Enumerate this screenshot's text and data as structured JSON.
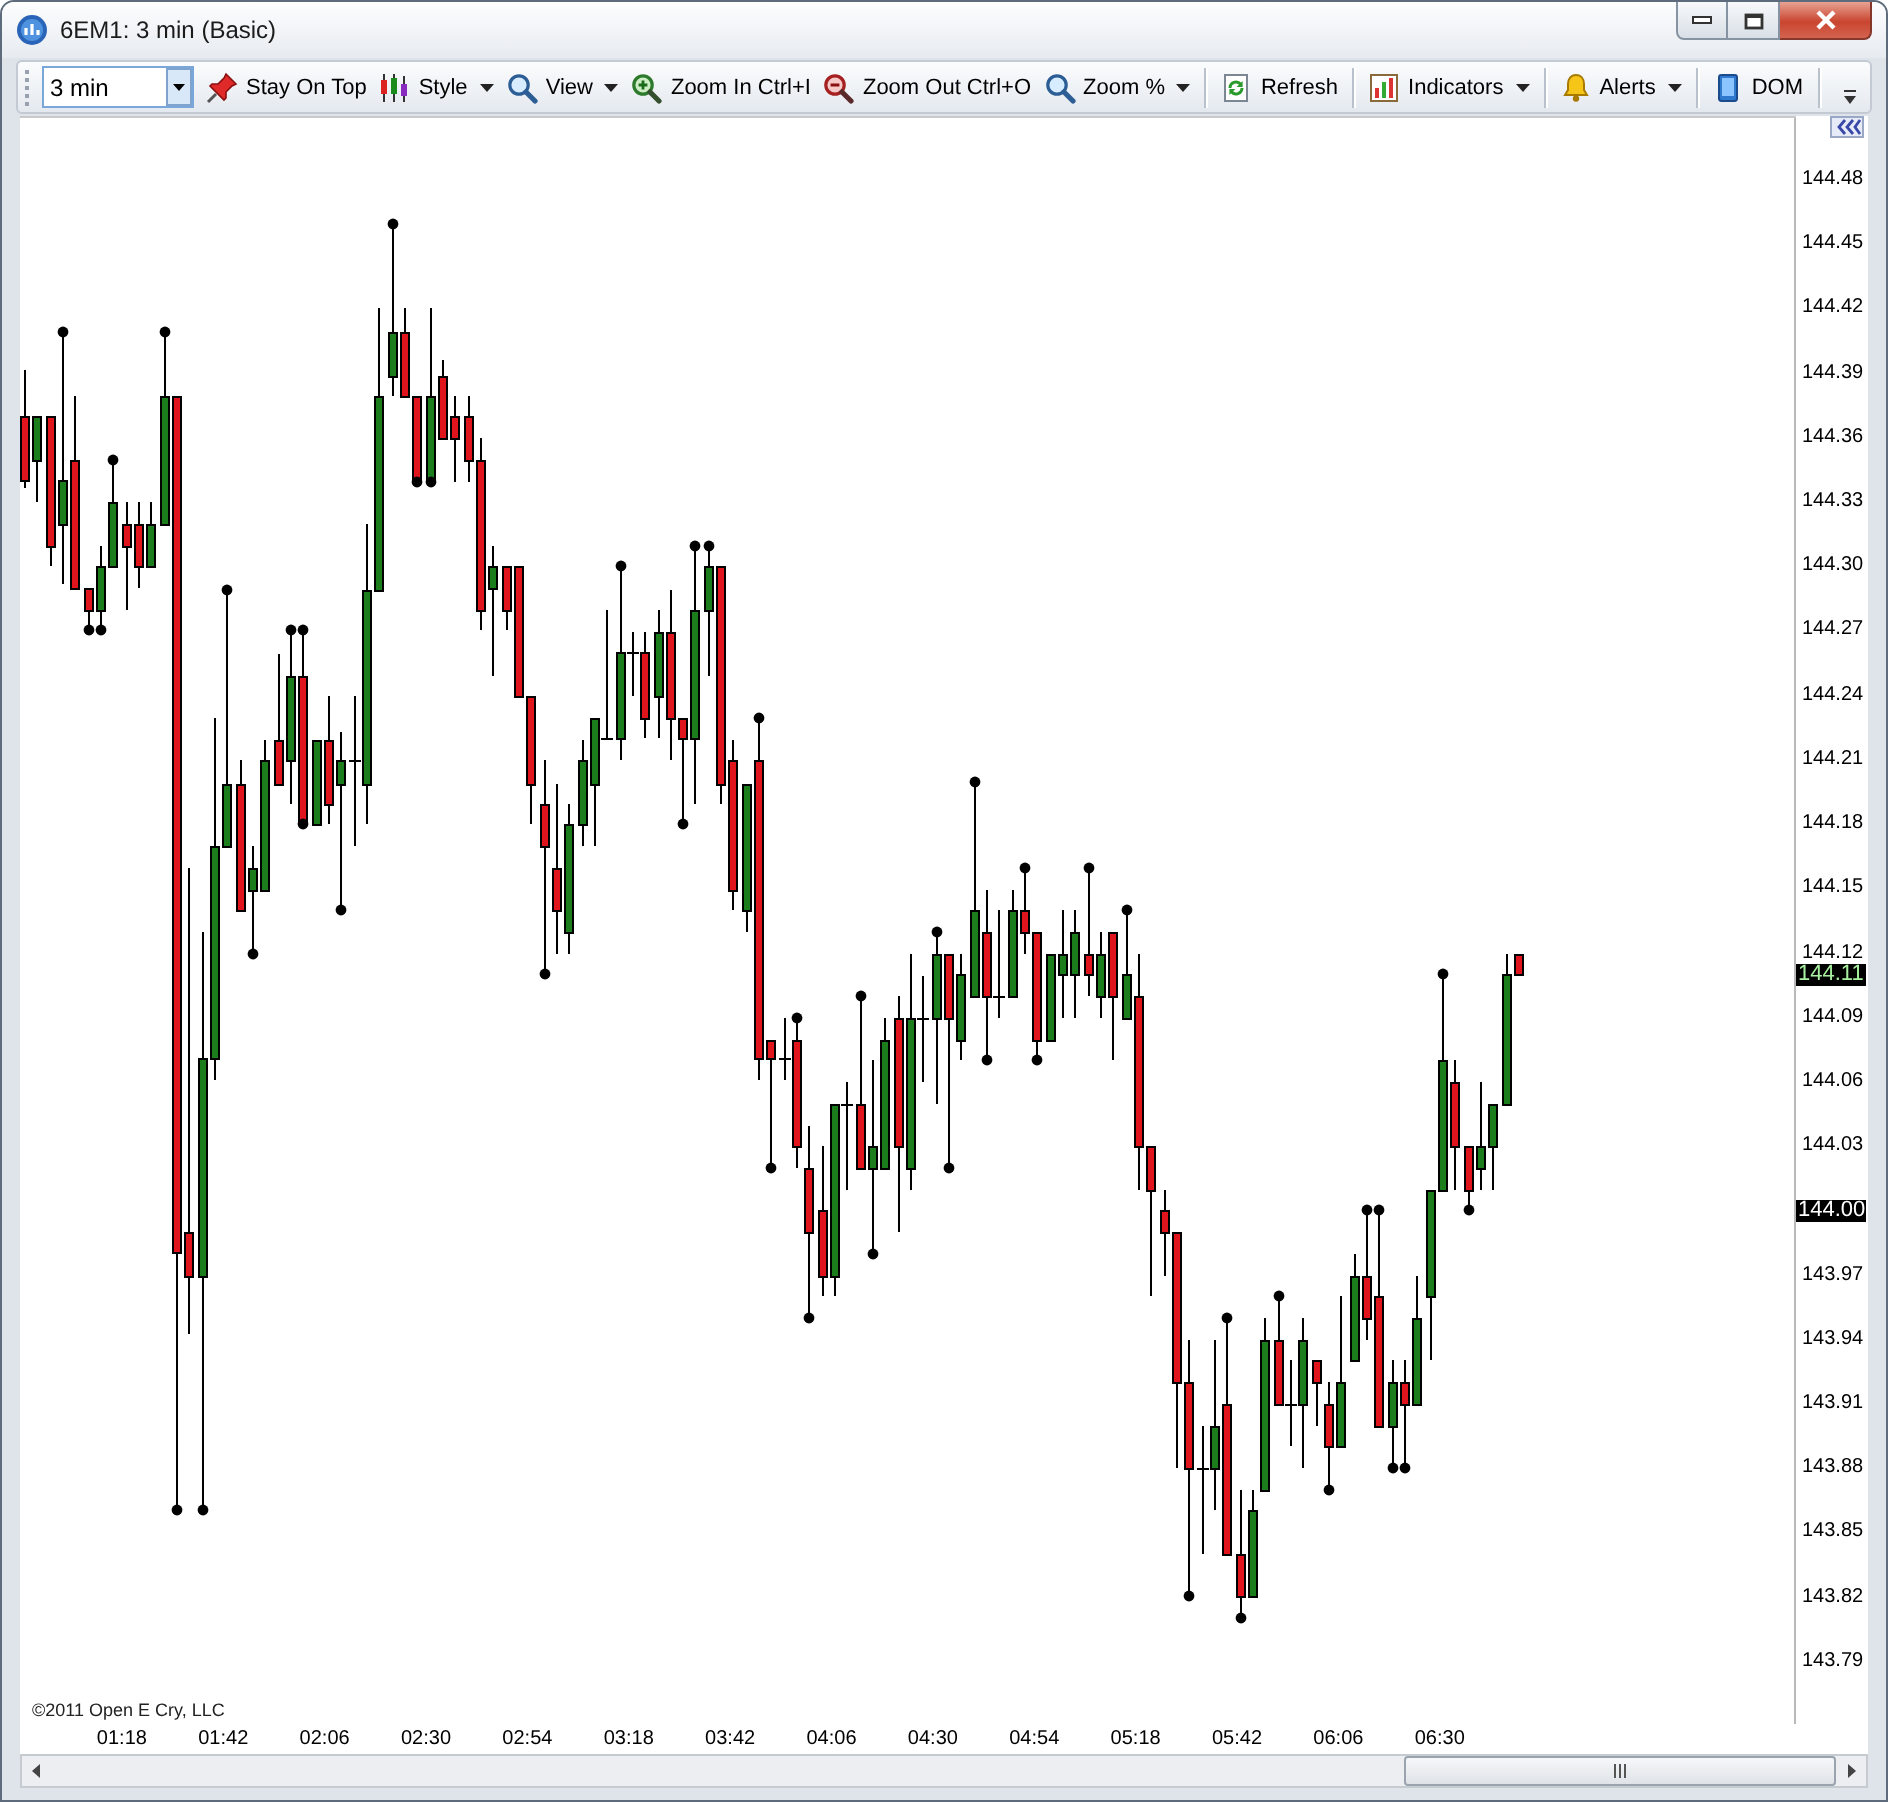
{
  "window": {
    "title": "6EM1: 3 min (Basic)"
  },
  "toolbar": {
    "interval": {
      "value": "3 min"
    },
    "groups": [
      [
        {
          "label": "Stay On Top",
          "dropdown": false
        },
        {
          "label": "Style",
          "dropdown": true
        },
        {
          "label": "View",
          "dropdown": true
        },
        {
          "label": "Zoom In Ctrl+I",
          "dropdown": false
        },
        {
          "label": "Zoom Out Ctrl+O",
          "dropdown": false
        },
        {
          "label": "Zoom %",
          "dropdown": true
        }
      ],
      [
        {
          "label": "Refresh",
          "dropdown": false
        }
      ],
      [
        {
          "label": "Indicators",
          "dropdown": true
        }
      ],
      [
        {
          "label": "Alerts",
          "dropdown": true
        }
      ],
      [
        {
          "label": "DOM",
          "dropdown": false
        }
      ]
    ]
  },
  "chart": {
    "price_axis": {
      "ticks": [
        "144.48",
        "144.45",
        "144.42",
        "144.39",
        "144.36",
        "144.33",
        "144.30",
        "144.27",
        "144.24",
        "144.21",
        "144.18",
        "144.15",
        "144.12",
        "144.09",
        "144.06",
        "144.03",
        "143.97",
        "143.94",
        "143.91",
        "143.88",
        "143.85",
        "143.82",
        "143.79"
      ],
      "markers": [
        {
          "label": "144.11",
          "kind": "last"
        },
        {
          "label": "144.00",
          "kind": "level"
        }
      ]
    },
    "time_axis": {
      "ticks": [
        "01:18",
        "01:42",
        "02:06",
        "02:30",
        "02:54",
        "03:18",
        "03:42",
        "04:06",
        "04:30",
        "04:54",
        "05:18",
        "05:42",
        "06:06",
        "06:30"
      ]
    },
    "copyright": "©2011 Open E Cry, LLC"
  }
}
